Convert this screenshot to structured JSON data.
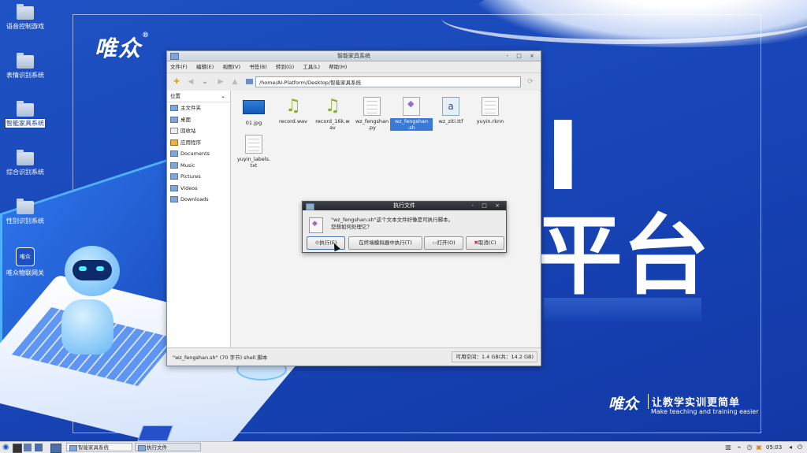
{
  "desktop": {
    "brand": "唯众",
    "brand_reg": "®",
    "big_glyph_1": "I",
    "big_glyph_2": "平台",
    "slogan_logo": "唯众",
    "slogan_zh": "让教学实训更简单",
    "slogan_en": "Make teaching and training easier",
    "icons": [
      {
        "label": "语音控制游戏"
      },
      {
        "label": "表情识别系统"
      },
      {
        "label": "智能家具系统",
        "selected": true
      },
      {
        "label": "综合识别系统"
      },
      {
        "label": "性别识别系统"
      },
      {
        "label": "唯众物联网关",
        "badge": "唯众"
      }
    ]
  },
  "window": {
    "title": "智能家具系统",
    "controls": "- □ ×",
    "menu": [
      "文件(F)",
      "编辑(E)",
      "视图(V)",
      "书签(B)",
      "转到(G)",
      "工具(L)",
      "帮助(H)"
    ],
    "path": "/home/AI-Platform/Desktop/智能家具系统",
    "sidebar": {
      "header": "位置",
      "items": [
        "主文件夹",
        "桌面",
        "回收站",
        "应用程序",
        "Documents",
        "Music",
        "Pictures",
        "Videos",
        "Downloads"
      ]
    },
    "files": [
      {
        "name": "01.jpg",
        "type": "jpg"
      },
      {
        "name": "record.wav",
        "type": "wav"
      },
      {
        "name": "record_16k.w\nav",
        "type": "wav"
      },
      {
        "name": "wz_fengshan\n.py",
        "type": "doc"
      },
      {
        "name": "wz_fengshan\n.sh",
        "type": "sh",
        "selected": true
      },
      {
        "name": "wz_ziti.ttf",
        "type": "ttf"
      },
      {
        "name": "yuyin.rknn",
        "type": "doc"
      },
      {
        "name": "yuyin_labels.\ntxt",
        "type": "doc"
      }
    ],
    "status_left": "\"wz_fengshan.sh\" (70 字节) shell 脚本",
    "status_right": "可用空间：1.4 GB(共：14.2 GB)"
  },
  "dialog": {
    "title": "执行文件",
    "controls": "- □ ×",
    "message_1": "\"wz_fengshan.sh\"这个文本文件好像是可执行脚本。",
    "message_2": "您想如何处理它？",
    "buttons": [
      "执行(E)",
      "在终端模拟器中执行(T)",
      "打开(O)",
      "取消(C)"
    ]
  },
  "taskbar": {
    "tasks": [
      "智能家具系统",
      "执行文件"
    ],
    "clock": "05:03"
  }
}
